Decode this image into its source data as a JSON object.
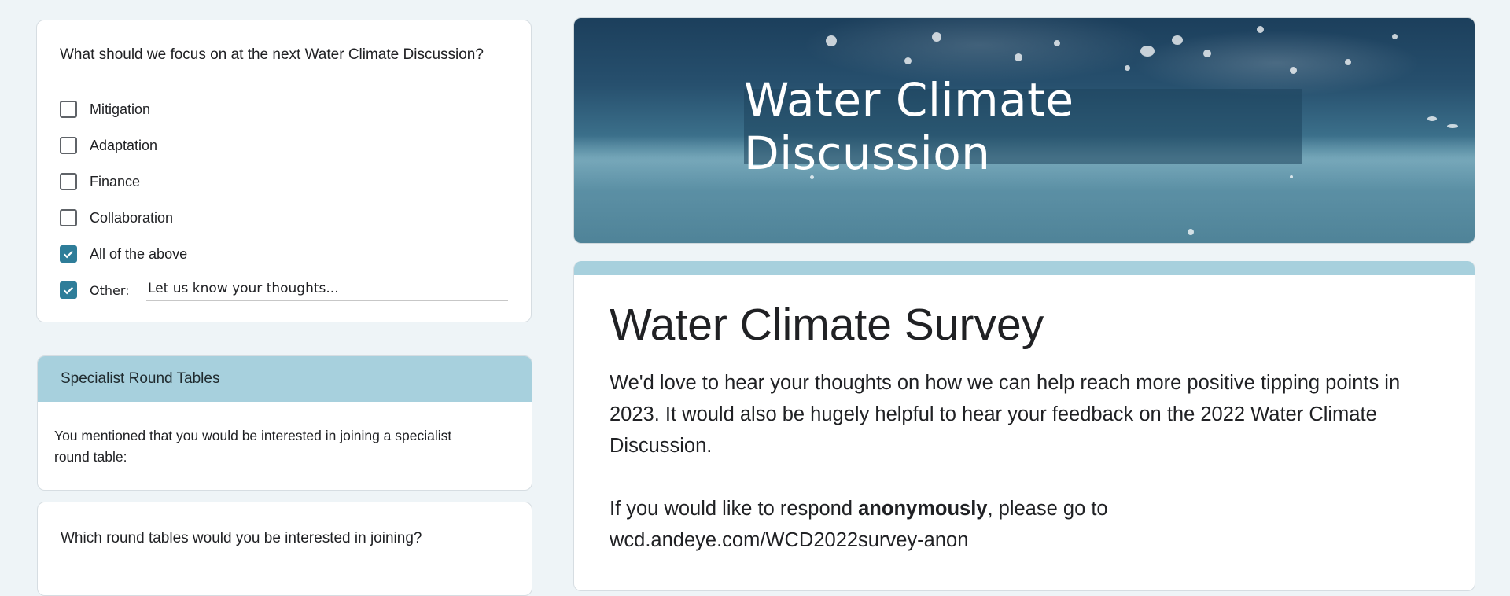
{
  "focus_question": {
    "title": "What should we focus on at the next Water Climate Discussion?",
    "options": [
      {
        "label": "Mitigation",
        "checked": false
      },
      {
        "label": "Adaptation",
        "checked": false
      },
      {
        "label": "Finance",
        "checked": false
      },
      {
        "label": "Collaboration",
        "checked": false
      },
      {
        "label": "All of the above",
        "checked": true
      }
    ],
    "other": {
      "label": "Other:",
      "checked": true,
      "placeholder": "Let us know your thoughts..."
    }
  },
  "section": {
    "title": "Specialist Round Tables",
    "description": "You mentioned that you would be interested in joining a specialist round table:"
  },
  "round_tables_question": {
    "title": "Which round tables would you be interested in joining?"
  },
  "banner": {
    "title": "Water Climate Discussion"
  },
  "form": {
    "title": "Water Climate Survey",
    "description_1": "We'd love to hear your thoughts on how we can help reach more positive tipping points in 2023.  It would also be hugely helpful to hear your feedback on the 2022 Water Climate Discussion.",
    "anon_prefix": "If you would like to respond ",
    "anon_bold": "anonymously",
    "anon_suffix": ", please go to",
    "anon_link": "wcd.andeye.com/WCD2022survey-anon"
  },
  "colors": {
    "accent": "#a7d0dd",
    "checkbox": "#2e7d99",
    "background": "#eef4f7"
  }
}
